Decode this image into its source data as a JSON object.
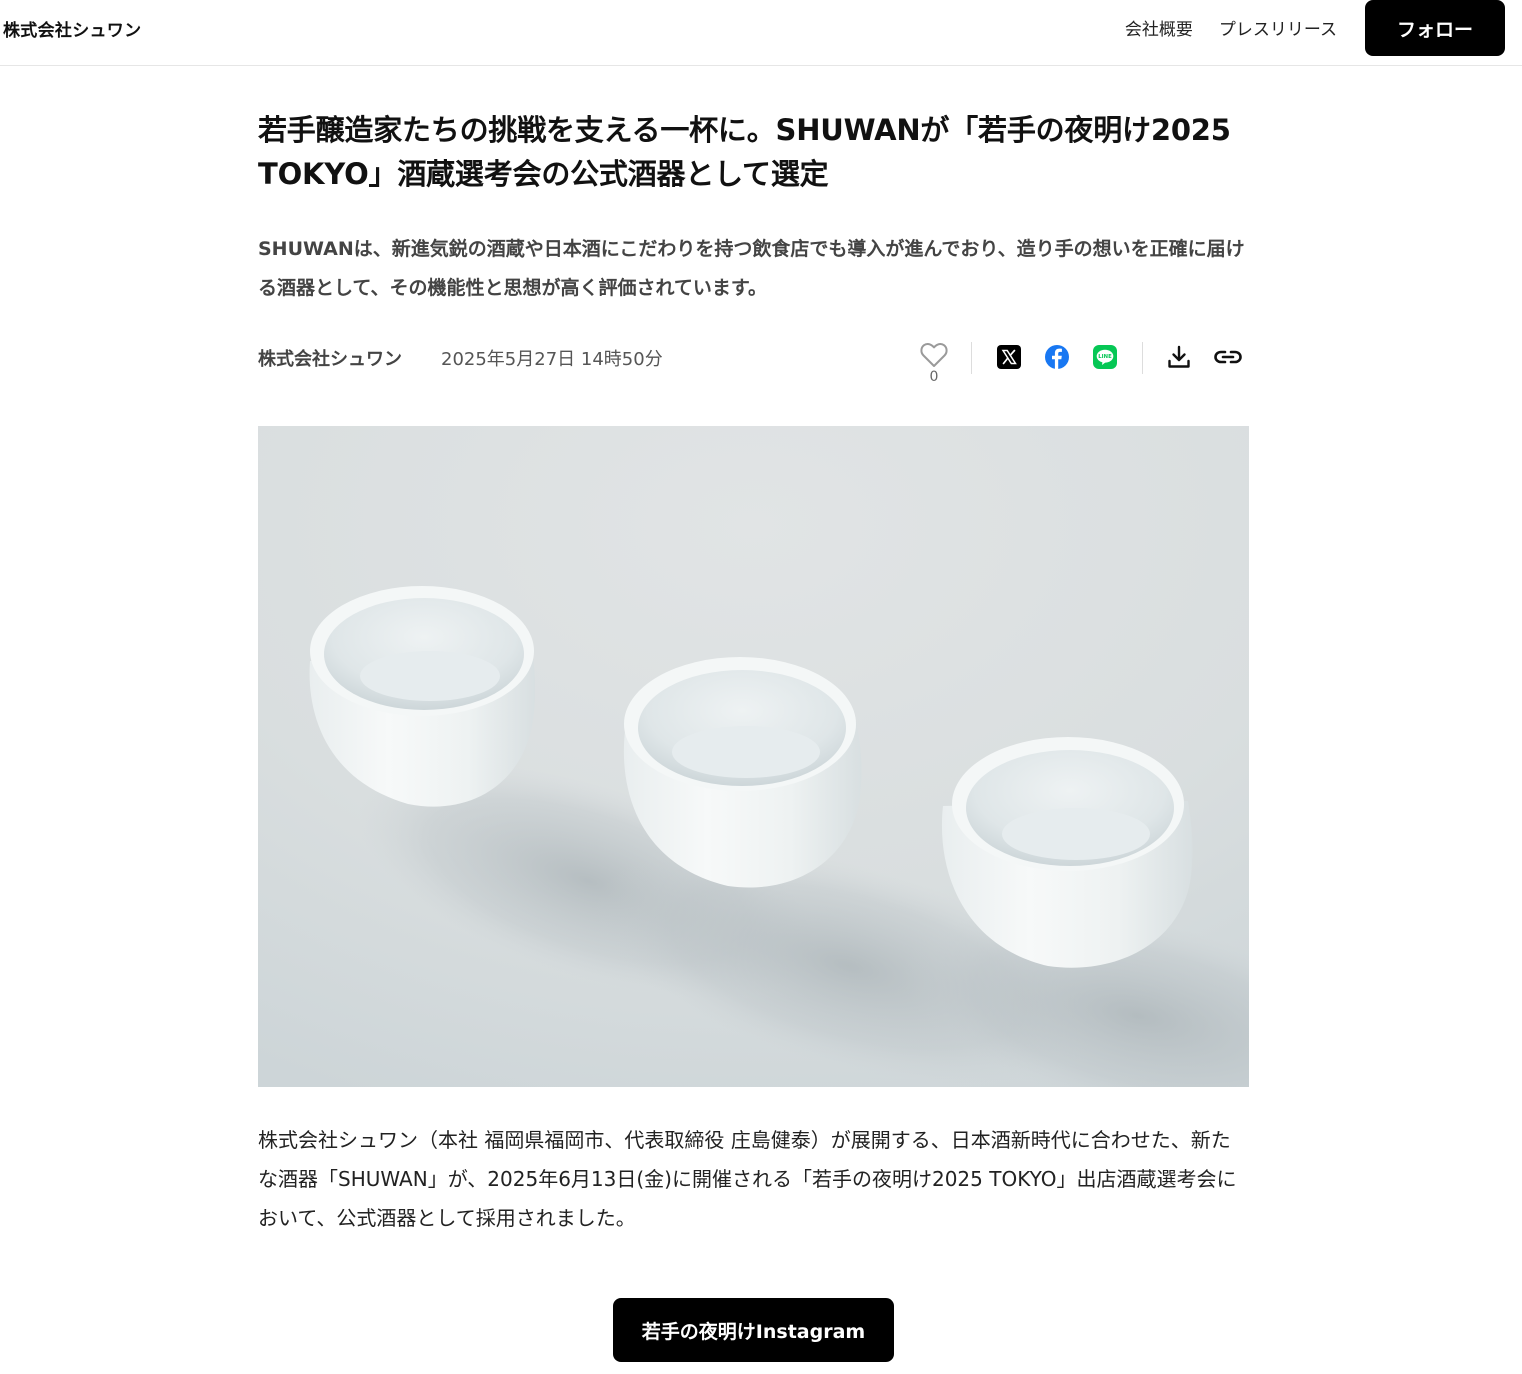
{
  "header": {
    "brand": "株式会社シュワン",
    "nav": [
      "会社概要",
      "プレスリリース"
    ],
    "follow_label": "フォロー"
  },
  "article": {
    "title": "若手醸造家たちの挑戦を支える一杯に。SHUWANが「若手の夜明け2025 TOKYO」酒蔵選考会の公式酒器として選定",
    "lead": "SHUWANは、新進気鋭の酒蔵や日本酒にこだわりを持つ飲食店でも導入が進んでおり、造り手の想いを正確に届ける酒器として、その機能性と思想が高く評価されています。",
    "company": "株式会社シュワン",
    "date": "2025年5月27日 14時50分",
    "like_count": "0",
    "share_icons": [
      "x-icon",
      "facebook-icon",
      "line-icon"
    ],
    "action_icons": [
      "download-icon",
      "link-icon"
    ],
    "image_subject": "three white sake cups",
    "body": "株式会社シュワン（本社 福岡県福岡市、代表取締役 庄島健泰）が展開する、日本酒新時代に合わせた、新たな酒器「SHUWAN」が、2025年6月13日(金)に開催される「若手の夜明け2025 TOKYO」出店酒蔵選考会において、公式酒器として採用されました。",
    "cta_label": "若手の夜明けInstagram"
  },
  "colors": {
    "primary_button": "#000000",
    "facebook": "#1877F2",
    "line": "#06C755",
    "x": "#000000"
  }
}
